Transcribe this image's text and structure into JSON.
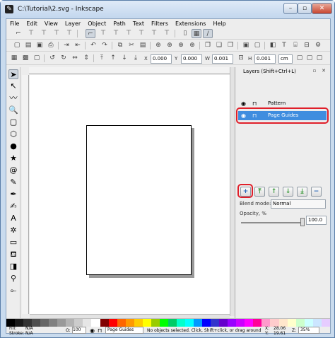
{
  "window": {
    "title": "C:\\Tutorial\\2.svg - Inkscape",
    "app_icon": "inkscape-icon",
    "minimize": "–",
    "maximize": "▫",
    "close": "✕"
  },
  "menu": [
    "File",
    "Edit",
    "View",
    "Layer",
    "Object",
    "Path",
    "Text",
    "Filters",
    "Extensions",
    "Help"
  ],
  "select_toolbar": {
    "x_label": "X",
    "x_value": "0.000",
    "y_label": "Y",
    "y_value": "0.000",
    "w_label": "W",
    "w_value": "0.001",
    "h_label": "H",
    "h_value": "0.001",
    "unit": "cm"
  },
  "layers_panel": {
    "title": "Layers (Shift+Ctrl+L)",
    "layers": [
      {
        "name": "Pattern",
        "selected": false
      },
      {
        "name": "Page Guides",
        "selected": true
      }
    ],
    "blend_label": "Blend mode:",
    "blend_value": "Normal",
    "opacity_label": "Opacity, %",
    "opacity_value": "100.0",
    "buttons": [
      "add-layer",
      "raise-to-top",
      "raise",
      "lower",
      "lower-to-bottom",
      "delete-layer"
    ]
  },
  "palette": [
    "#000000",
    "#1a1a1a",
    "#333333",
    "#4d4d4d",
    "#666666",
    "#808080",
    "#999999",
    "#b3b3b3",
    "#cccccc",
    "#e6e6e6",
    "#ffffff",
    "#800000",
    "#ff0000",
    "#ff6600",
    "#ff9900",
    "#ffcc00",
    "#ffff00",
    "#99cc00",
    "#00ff00",
    "#00cc66",
    "#00ffcc",
    "#00ffff",
    "#0099ff",
    "#0000ff",
    "#3333cc",
    "#6600cc",
    "#9900ff",
    "#cc00ff",
    "#ff00ff",
    "#ff0099",
    "#ff99cc",
    "#ffcccc",
    "#ffe6cc",
    "#ffffcc",
    "#ccffcc",
    "#ccffff",
    "#cce6ff",
    "#e6ccff"
  ],
  "status": {
    "fill_label": "Fill:",
    "fill_value": "N/A",
    "stroke_label": "Stroke:",
    "stroke_value": "N/A",
    "opacity_label": "O:",
    "opacity_value": "100",
    "layer": "Page Guides",
    "message": "No objects selected. Click, Shift+click, or drag around",
    "x_label": "X:",
    "x_value": "28.06",
    "y_label": "Y:",
    "y_value": "19.61",
    "zoom_label": "Z:",
    "zoom_value": "35%"
  }
}
